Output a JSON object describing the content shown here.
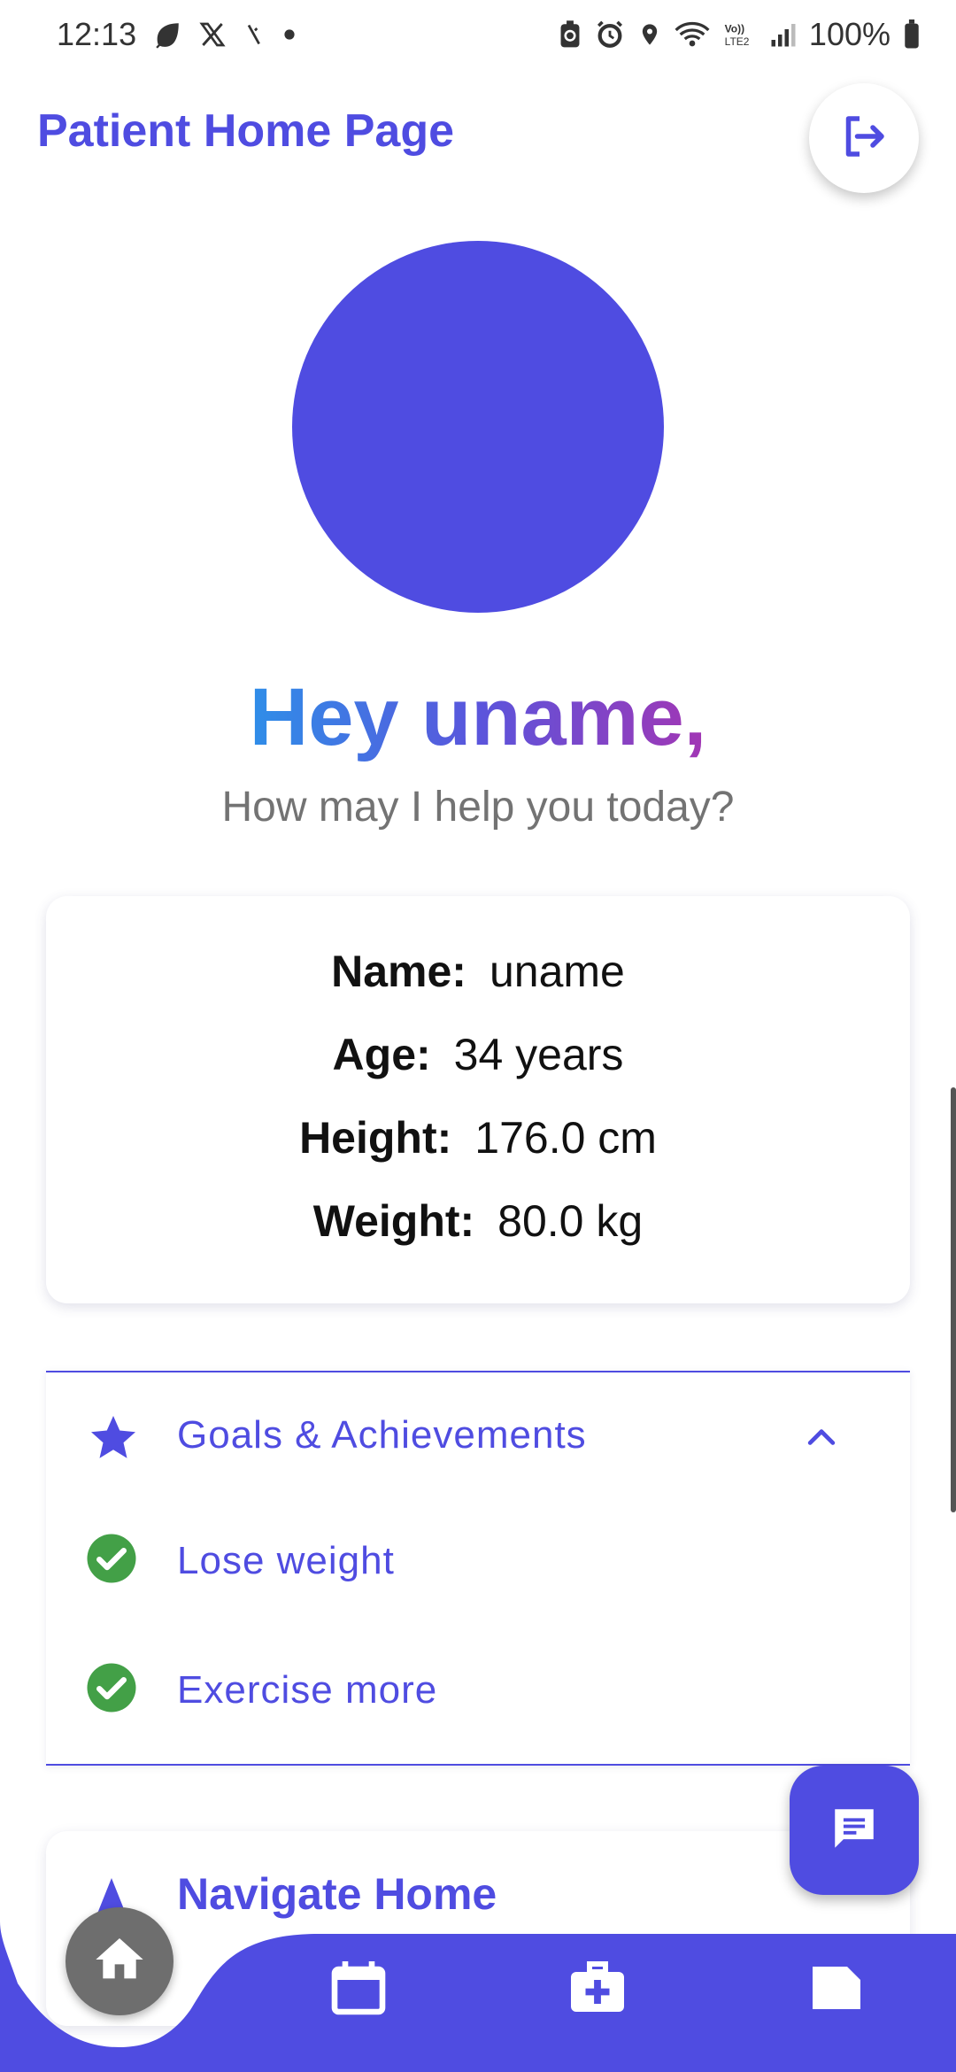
{
  "status_bar": {
    "time": "12:13",
    "battery": "100%",
    "network": "VoLTE2"
  },
  "header": {
    "title": "Patient Home Page"
  },
  "greeting": {
    "title": "Hey uname,",
    "subtitle": "How may I help you today?"
  },
  "profile": {
    "name_label": "Name:",
    "name_value": "uname",
    "age_label": "Age:",
    "age_value": "34 years",
    "height_label": "Height:",
    "height_value": "176.0 cm",
    "weight_label": "Weight:",
    "weight_value": "80.0 kg"
  },
  "goals": {
    "title": "Goals & Achievements",
    "expanded": true,
    "items": [
      {
        "label": "Lose weight",
        "done": true
      },
      {
        "label": "Exercise more",
        "done": true
      }
    ]
  },
  "nav_card": {
    "title": "Navigate Home"
  },
  "colors": {
    "accent": "#4f4ce1",
    "check": "#43a047",
    "home_button": "#6e6e6e"
  },
  "bottom_nav": {
    "items": [
      "home-icon",
      "calendar-icon",
      "medical-kit-icon",
      "note-icon"
    ]
  }
}
